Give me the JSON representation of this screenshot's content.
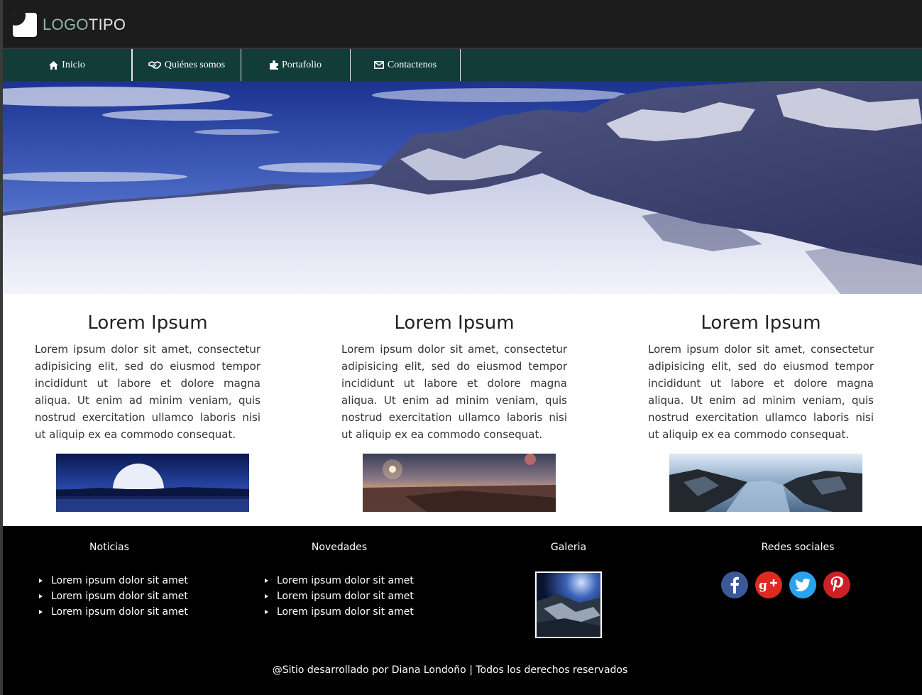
{
  "header": {
    "logo_part1": "LOGO",
    "logo_part2": "TIPO",
    "logo_icon": "logo-icon"
  },
  "nav": {
    "items": [
      {
        "label": "Inicio",
        "icon": "home-icon"
      },
      {
        "label": "Quiénes somos",
        "icon": "handshake-icon"
      },
      {
        "label": "Portafolio",
        "icon": "puzzle-icon"
      },
      {
        "label": "Contactenos",
        "icon": "envelope-icon"
      }
    ]
  },
  "hero": {
    "image": "snowy-mountains-image"
  },
  "columns": [
    {
      "title": "Lorem Ipsum",
      "text": "Lorem ipsum dolor sit amet, consectetur adipisicing elit, sed do eiusmod tempor incididunt ut labore et dolore magna aliqua. Ut enim ad minim veniam, quis nostrud exercitation ullamco laboris nisi ut aliquip ex ea commodo consequat.",
      "image": "moon-landscape-image"
    },
    {
      "title": "Lorem Ipsum",
      "text": "Lorem ipsum dolor sit amet, consectetur adipisicing elit, sed do eiusmod tempor incididunt ut labore et dolore magna aliqua. Ut enim ad minim veniam, quis nostrud exercitation ullamco laboris nisi ut aliquip ex ea commodo consequat.",
      "image": "sunset-planet-image"
    },
    {
      "title": "Lorem Ipsum",
      "text": "Lorem ipsum dolor sit amet, consectetur adipisicing elit, sed do eiusmod tempor incididunt ut labore et dolore magna aliqua. Ut enim ad minim veniam, quis nostrud exercitation ullamco laboris nisi ut aliquip ex ea commodo consequat.",
      "image": "fjord-landscape-image"
    }
  ],
  "footer": {
    "noticias": {
      "title": "Noticias",
      "items": [
        "Lorem ipsum dolor sit amet",
        "Lorem ipsum dolor sit amet",
        "Lorem ipsum dolor sit amet"
      ]
    },
    "novedades": {
      "title": "Novedades",
      "items": [
        "Lorem ipsum dolor sit amet",
        "Lorem ipsum dolor sit amet",
        "Lorem ipsum dolor sit amet"
      ]
    },
    "galeria": {
      "title": "Galeria",
      "image": "gallery-thumbnail-image"
    },
    "redes": {
      "title": "Redes sociales",
      "icons": [
        "facebook-icon",
        "google-plus-icon",
        "twitter-icon",
        "pinterest-icon"
      ]
    },
    "copyright": "@Sitio desarrollado por Diana Londoño | Todos los derechos reservados"
  },
  "colors": {
    "header_bg": "#1c1c1c",
    "nav_bg": "#113c37",
    "logo_accent": "#8fb9a8",
    "footer_bg": "#000000"
  }
}
